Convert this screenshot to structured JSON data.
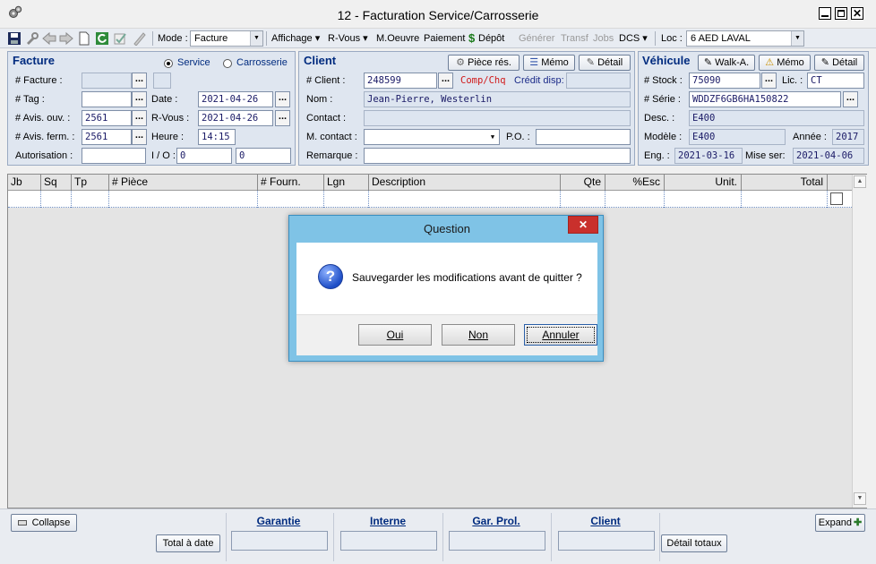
{
  "window": {
    "title": "12 -  Facturation Service/Carrosserie"
  },
  "toolbar": {
    "mode_label": "Mode :",
    "mode_value": "Facture",
    "items": {
      "affichage": "Affichage ▾",
      "rvous": "R-Vous ▾",
      "moeuvre": "M.Oeuvre",
      "paiement": "Paiement",
      "depot": "Dépôt",
      "generer": "Générer",
      "transf": "Transf",
      "jobs": "Jobs",
      "dcs": "DCS ▾"
    },
    "loc_label": "Loc :",
    "loc_value": "6 AED LAVAL"
  },
  "facture": {
    "title": "Facture",
    "radio_service": "Service",
    "radio_carrosserie": "Carrosserie",
    "lbl_facture": "# Facture :",
    "lbl_tag": "# Tag :",
    "lbl_date": "Date :",
    "date": "2021-04-26",
    "lbl_avis_ouv": "# Avis. ouv. :",
    "avis_ouv": "2561",
    "lbl_rvous": "R-Vous :",
    "rvous": "2021-04-26",
    "lbl_avis_ferm": "# Avis. ferm. :",
    "avis_ferm": "2561",
    "lbl_heure": "Heure :",
    "heure": "14:15",
    "lbl_autorisation": "Autorisation :",
    "lbl_io": "I / O :",
    "io_1": "0",
    "io_2": "0"
  },
  "client": {
    "title": "Client",
    "btn_piece_res": "Pièce rés.",
    "btn_memo": "Mémo",
    "btn_detail": "Détail",
    "lbl_client": "# Client :",
    "client_no": "248599",
    "comp_chq": "Comp/Chq",
    "credit_disp": "Crédit disp:",
    "lbl_nom": "Nom :",
    "nom": "Jean-Pierre, Westerlin",
    "lbl_contact": "Contact :",
    "lbl_m_contact": "M. contact :",
    "lbl_po": "P.O. :",
    "lbl_remarque": "Remarque :"
  },
  "vehicule": {
    "title": "Véhicule",
    "btn_walk": "Walk-A.",
    "btn_memo": "Mémo",
    "btn_detail": "Détail",
    "lbl_stock": "# Stock :",
    "stock": "75090",
    "lbl_lic": "Lic. :",
    "lic": "CT",
    "lbl_serie": "# Série :",
    "serie": "WDDZF6GB6HA150822",
    "lbl_desc": "Desc. :",
    "desc": "E400",
    "lbl_modele": "Modèle :",
    "modele": "E400",
    "lbl_annee": "Année :",
    "annee": "2017",
    "lbl_eng": "Eng. :",
    "eng": "2021-03-16",
    "lbl_mise_ser": "Mise ser:",
    "mise_ser": "2021-04-06"
  },
  "grid": {
    "columns": [
      "Jb",
      "Sq",
      "Tp",
      "# Pièce",
      "# Fourn.",
      "Lgn",
      "Description",
      "Qte",
      "%Esc",
      "Unit.",
      "Total"
    ]
  },
  "footer": {
    "collapse": "Collapse",
    "total_a_date": "Total à date",
    "garantie": "Garantie",
    "interne": "Interne",
    "gar_prol": "Gar. Prol.",
    "client": "Client",
    "detail_totaux": "Détail totaux",
    "expand": "Expand"
  },
  "dialog": {
    "title": "Question",
    "message": "Sauvegarder les modifications avant de quitter ?",
    "btn_oui": "Oui",
    "btn_non": "Non",
    "btn_annuler": "Annuler"
  }
}
